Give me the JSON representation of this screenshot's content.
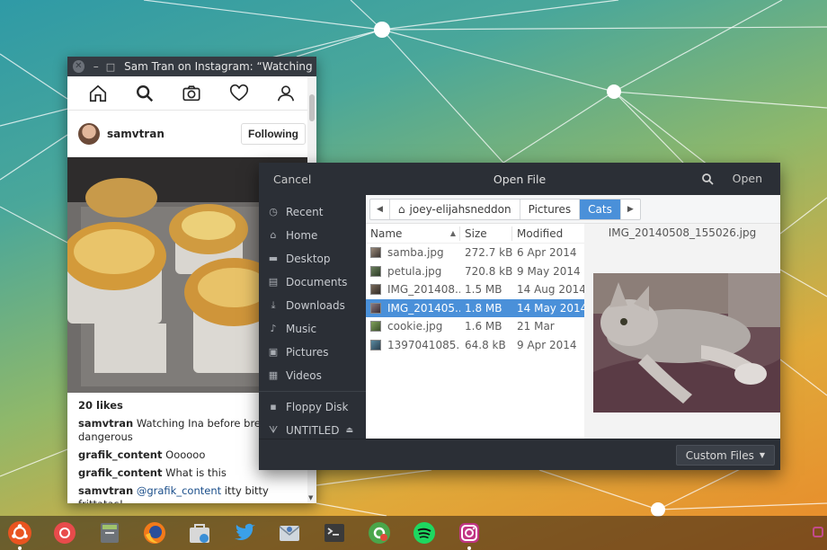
{
  "instagram": {
    "window_title": "Sam Tran on Instagram: “Watching In...",
    "username": "samvtran",
    "follow_label": "Following",
    "likes": "20 likes",
    "comments": [
      {
        "user": "samvtran",
        "text": " Watching Ina before breakfast is dangerous"
      },
      {
        "user": "grafik_content",
        "text": " Oooooo"
      },
      {
        "user": "grafik_content",
        "text": " What is this"
      },
      {
        "user": "samvtran",
        "mention": "@grafik_content",
        "text": " itty bitty frittatas!"
      }
    ],
    "nav_icons": [
      "home-icon",
      "search-icon",
      "camera-icon",
      "heart-icon",
      "profile-icon"
    ]
  },
  "file_dialog": {
    "cancel_label": "Cancel",
    "title": "Open File",
    "open_label": "Open",
    "sidebar": [
      {
        "label": "Recent",
        "icon": "clock-icon"
      },
      {
        "label": "Home",
        "icon": "home-icon"
      },
      {
        "label": "Desktop",
        "icon": "desktop-icon"
      },
      {
        "label": "Documents",
        "icon": "document-icon"
      },
      {
        "label": "Downloads",
        "icon": "download-icon"
      },
      {
        "label": "Music",
        "icon": "music-icon"
      },
      {
        "label": "Pictures",
        "icon": "picture-icon"
      },
      {
        "label": "Videos",
        "icon": "video-icon"
      },
      {
        "label": "Floppy Disk",
        "icon": "floppy-icon"
      },
      {
        "label": "UNTITLED",
        "icon": "usb-icon"
      }
    ],
    "path": [
      {
        "label": "joey-elijahsneddon",
        "home": true
      },
      {
        "label": "Pictures"
      },
      {
        "label": "Cats",
        "active": true
      }
    ],
    "columns": {
      "name": "Name",
      "size": "Size",
      "modified": "Modified"
    },
    "files": [
      {
        "name": "samba.jpg",
        "size": "272.7 kB",
        "modified": "6 Apr 2014"
      },
      {
        "name": "petula.jpg",
        "size": "720.8 kB",
        "modified": "9 May 2014"
      },
      {
        "name": "IMG_201408...",
        "size": "1.5 MB",
        "modified": "14 Aug 2014"
      },
      {
        "name": "IMG_201405...",
        "size": "1.8 MB",
        "modified": "14 May 2014",
        "selected": true
      },
      {
        "name": "cookie.jpg",
        "size": "1.6 MB",
        "modified": "21 Mar"
      },
      {
        "name": "1397041085...",
        "size": "64.8 kB",
        "modified": "9 Apr 2014"
      }
    ],
    "preview_name": "IMG_20140508_155026.jpg",
    "filter_label": "Custom Files"
  },
  "dock": [
    "ubuntu-icon",
    "chromium-icon",
    "files-icon",
    "firefox-icon",
    "software-store-icon",
    "twitter-icon",
    "mail-icon",
    "terminal-icon",
    "settings-icon",
    "spotify-icon",
    "instagram-icon"
  ],
  "colors": {
    "accent": "#4a90d9",
    "dialog_bg": "#2b2f36",
    "titlebar": "#353a41"
  }
}
